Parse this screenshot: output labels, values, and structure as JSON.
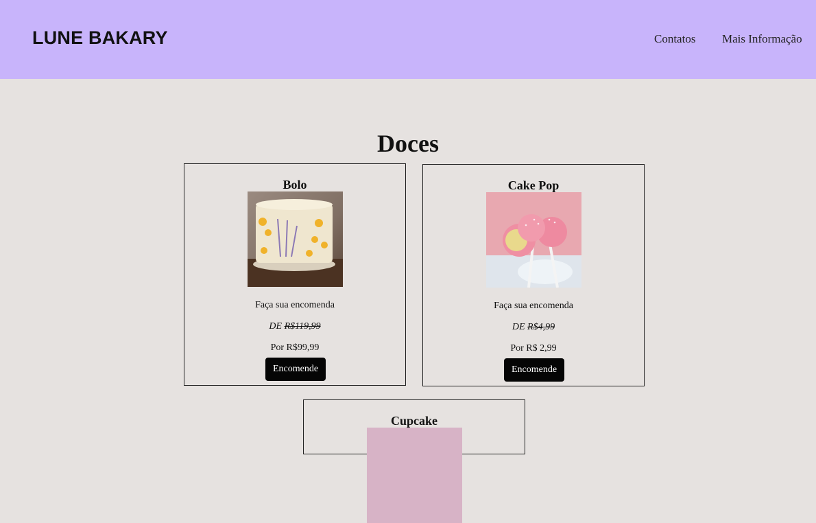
{
  "header": {
    "brand": "LUNE BAKARY",
    "nav": {
      "contatos": "Contatos",
      "mais": "Mais Informação"
    },
    "background": "#c8b4fb"
  },
  "main": {
    "section_title": "Doces",
    "products": [
      {
        "name": "Bolo",
        "cta_text": "Faça sua encomenda",
        "old_prefix": "DE",
        "old_price": "R$119,99",
        "new_price": "Por R$99,99",
        "button": "Encomende"
      },
      {
        "name": "Cake Pop",
        "cta_text": "Faça sua encomenda",
        "old_prefix": "DE",
        "old_price": "R$4,99",
        "new_price": "Por R$ 2,99",
        "button": "Encomende"
      },
      {
        "name": "Cupcake"
      }
    ]
  },
  "colors": {
    "page_bg": "#e6e2e0",
    "button_bg": "#050505",
    "button_text": "#ffffff"
  }
}
